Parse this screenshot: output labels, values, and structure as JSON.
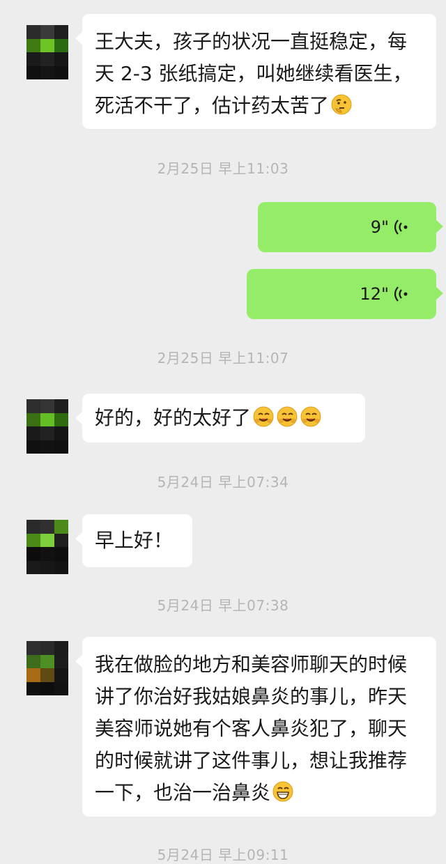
{
  "messages": {
    "m1": {
      "text": "王大夫，孩子的状况一直挺稳定，每天 2-3 张纸搞定，叫她继续看医生，死活不干了，估计药太苦了",
      "emoji": [
        "thinking-face-emoji"
      ]
    },
    "m4": {
      "text": "好的，好的太好了",
      "emoji": [
        "smiling-face-emoji",
        "smiling-face-emoji",
        "smiling-face-emoji"
      ]
    },
    "m5": {
      "text": "早上好！"
    },
    "m6": {
      "text": "我在做脸的地方和美容师聊天的时候讲了你治好我姑娘鼻炎的事儿，昨天美容师说她有个客人鼻炎犯了，聊天的时候就讲了这件事儿，想让我推荐一下，也治一治鼻炎",
      "emoji": [
        "grinning-face-emoji"
      ]
    }
  },
  "timestamps": {
    "t1": "2月25日 早上11:03",
    "t2": "2月25日 早上11:07",
    "t3": "5月24日 早上07:34",
    "t4": "5月24日 早上07:38",
    "t5": "5月24日 早上09:11"
  },
  "voice": {
    "v1": {
      "duration": "9\""
    },
    "v2": {
      "duration": "12\""
    }
  },
  "colors": {
    "background": "#ededed",
    "outgoing_bubble": "#95ec69",
    "incoming_bubble": "#ffffff",
    "timestamp_text": "#b5b5b5"
  }
}
